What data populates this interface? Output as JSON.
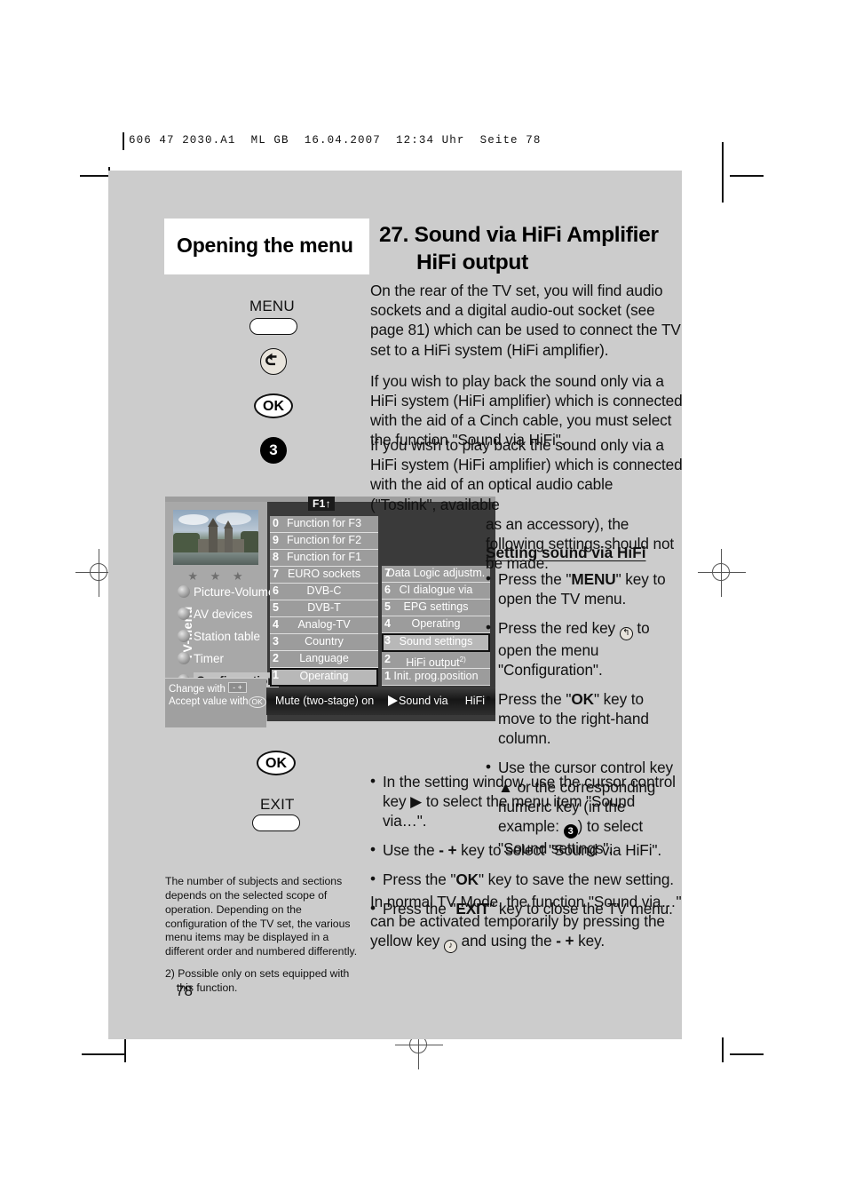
{
  "printer_header": "606 47 2030.A1  ML GB  16.04.2007  12:34 Uhr  Seite 78",
  "header": {
    "left_title": "Opening the menu",
    "right_title_line1": "27. Sound via HiFi Amplifier",
    "right_title_line2": "HiFi output"
  },
  "keys": {
    "menu_label": "MENU",
    "red_key_icon": "return-arrow-icon",
    "ok_label": "OK",
    "num_three": "3",
    "ok_label_2": "OK",
    "exit_label": "EXIT"
  },
  "tv_screen": {
    "vertical_label": "TV-Menu",
    "stars": "★ ★ ★",
    "f1_badge": "F1",
    "f1_arrow": "↑",
    "categories": [
      {
        "label": "Picture-Volume",
        "selected": false
      },
      {
        "label": "AV devices",
        "selected": false
      },
      {
        "label": "Station table",
        "selected": false
      },
      {
        "label": "Timer",
        "selected": false
      },
      {
        "label": "Configuration",
        "selected": true
      }
    ],
    "middle_list": [
      {
        "num": "0",
        "label": "Function for F3",
        "highlight": false
      },
      {
        "num": "9",
        "label": "Function for F2",
        "highlight": false
      },
      {
        "num": "8",
        "label": "Function for F1",
        "highlight": false
      },
      {
        "num": "7",
        "label": "EURO sockets",
        "highlight": false
      },
      {
        "num": "6",
        "label": "DVB-C",
        "highlight": false
      },
      {
        "num": "5",
        "label": "DVB-T",
        "highlight": false
      },
      {
        "num": "4",
        "label": "Analog-TV",
        "highlight": false
      },
      {
        "num": "3",
        "label": "Country",
        "highlight": false
      },
      {
        "num": "2",
        "label": "Language",
        "highlight": false
      },
      {
        "num": "1",
        "label": "Operating",
        "highlight": true
      }
    ],
    "right_list": [
      {
        "num": "7",
        "label": "Data Logic adjustm.",
        "highlight": false,
        "sup": ""
      },
      {
        "num": "6",
        "label": "CI dialogue via",
        "highlight": false,
        "sup": ""
      },
      {
        "num": "5",
        "label": "EPG settings",
        "highlight": false,
        "sup": ""
      },
      {
        "num": "4",
        "label": "Operating",
        "highlight": false,
        "sup": ""
      },
      {
        "num": "3",
        "label": "Sound settings",
        "highlight": true,
        "sup": ""
      },
      {
        "num": "2",
        "label": "HiFi output",
        "highlight": false,
        "sup": "2)"
      },
      {
        "num": "1",
        "label": "Init. prog.position",
        "highlight": false,
        "sup": ""
      }
    ],
    "hint_line1": "Change with",
    "hint_minus_plus": "- +",
    "hint_line2": "Accept value with",
    "hint_ok": "OK",
    "status_left": "Mute (two-stage) on",
    "status_right_label": "Sound via",
    "status_right_value": "HiFi"
  },
  "body": {
    "para1": "On the rear of the TV set, you will find audio sockets and a digital audio-out socket (see page 81) which can be used to connect the TV set to a HiFi system (HiFi amplifier).",
    "para2": "If you wish to play back the sound only via a HiFi system (HiFi amplifier) which is connected with the aid of a Cinch cable, you must select the function \"Sound via HiFi\".",
    "para3_wide": "If you wish to play back the sound only via a HiFi system (HiFi amplifier) which is connected with the aid of an optical audio cable (\"Toslink\", available",
    "para3_narrow": "as an accessory), the following settings should not be made.",
    "setting_heading": "Setting sound via HiFi",
    "bullet1_pre": "Press the \"",
    "bullet1_bold": "MENU",
    "bullet1_post": "\" key to open the TV menu.",
    "bullet2_pre": "Press the red key ",
    "bullet2_post": " to open the menu \"Configuration\".",
    "bullet3_pre": "Press the \"",
    "bullet3_bold": "OK",
    "bullet3_post": "\" key to move to the right-hand column.",
    "bullet4_pre": "Use the cursor control key ▲ or the corresponding numeric key (in the example: ",
    "bullet4_num": "3",
    "bullet4_post": ") to select \"Sound settings\".",
    "bullet5": "In the setting window, use the cursor control key ▶ to select the menu item \"Sound via…\".",
    "bullet6_pre": "Use the ",
    "bullet6_keys": "- +",
    "bullet6_post": " key to select \"Sound via HiFi\".",
    "bullet7_pre": "Press the \"",
    "bullet7_bold": "OK",
    "bullet7_post": "\" key to save the new setting.",
    "bullet8_pre": "Press the \"",
    "bullet8_bold": "EXIT",
    "bullet8_post": "\" key to close the TV menu.",
    "para_normal_pre": "In normal TV Mode, the function \"Sound via…\" can be activated temporarily by pressing the yellow key ",
    "para_normal_mid": " and using the ",
    "para_normal_keys": "- +",
    "para_normal_post": " key."
  },
  "footnotes": {
    "note1": "The number of subjects and sections depends on the selected scope of operation. Depending on the configuration of the TV set, the various menu items may be displayed in a different order and numbered differently.",
    "note2": "2) Possible only on sets equipped with this function."
  },
  "page_number": "78"
}
